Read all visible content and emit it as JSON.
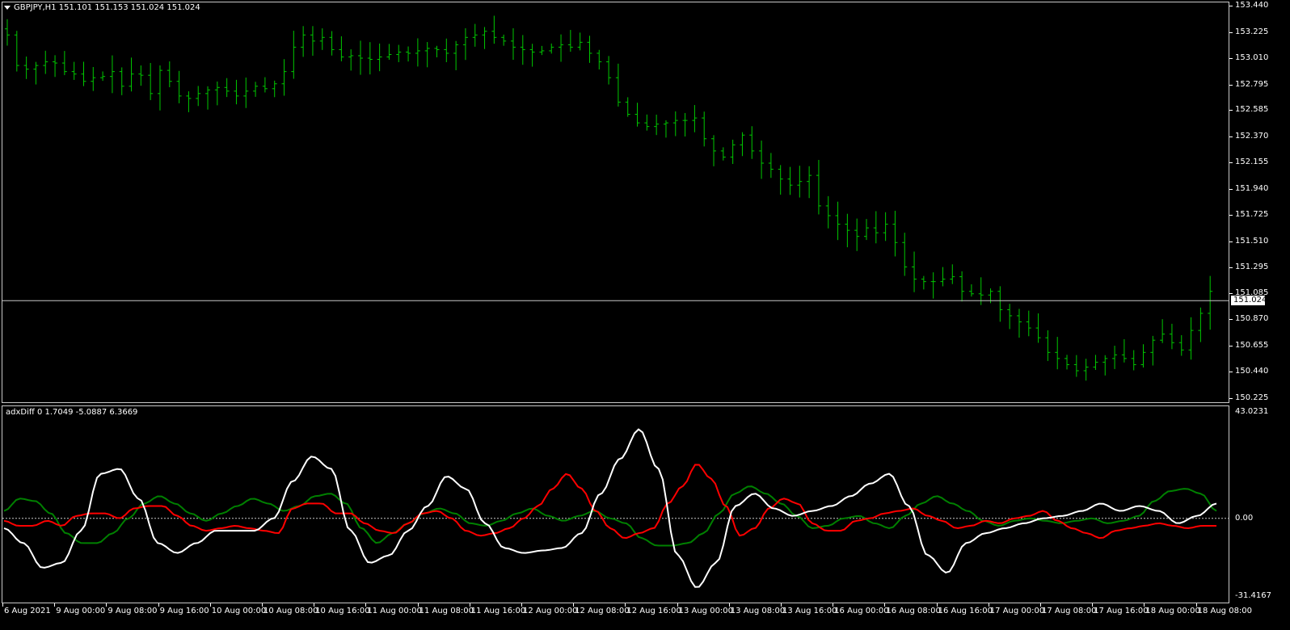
{
  "chart_title": "GBPJPY,H1  151.101 151.153 151.024 151.024",
  "current_price": "151.024",
  "indicator_title": "adxDiff 0 1.7049 -5.0887 6.3669",
  "price_axis": [
    "153.440",
    "153.225",
    "153.010",
    "152.795",
    "152.585",
    "152.370",
    "152.155",
    "151.940",
    "151.725",
    "151.510",
    "151.295",
    "151.085",
    "150.870",
    "150.655",
    "150.440",
    "150.225"
  ],
  "indicator_axis": [
    "43.0231",
    "0.00",
    "-31.4167"
  ],
  "time_axis": [
    "6 Aug 2021",
    "9 Aug 00:00",
    "9 Aug 08:00",
    "9 Aug 16:00",
    "10 Aug 00:00",
    "10 Aug 08:00",
    "10 Aug 16:00",
    "11 Aug 00:00",
    "11 Aug 08:00",
    "11 Aug 16:00",
    "12 Aug 00:00",
    "12 Aug 08:00",
    "12 Aug 16:00",
    "13 Aug 00:00",
    "13 Aug 08:00",
    "13 Aug 16:00",
    "16 Aug 00:00",
    "16 Aug 08:00",
    "16 Aug 16:00",
    "17 Aug 00:00",
    "17 Aug 08:00",
    "17 Aug 16:00",
    "18 Aug 00:00",
    "18 Aug 08:00"
  ],
  "colors": {
    "bars": "#00c800",
    "plus_di": "#008000",
    "minus_di": "#ff0000",
    "adx_diff": "#ffffff",
    "grid": "#c8c8c8"
  },
  "chart_data": {
    "type": "line",
    "price_range": [
      150.225,
      153.44
    ],
    "indicator_range": [
      -31.4167,
      43.0231
    ],
    "closes": [
      153.2,
      152.95,
      152.92,
      152.95,
      152.98,
      152.97,
      152.9,
      152.88,
      152.82,
      152.85,
      152.86,
      152.9,
      152.78,
      152.88,
      152.87,
      152.72,
      152.91,
      152.82,
      152.7,
      152.68,
      152.72,
      152.75,
      152.77,
      152.74,
      152.7,
      152.74,
      152.78,
      152.76,
      152.8,
      152.9,
      153.1,
      153.2,
      153.15,
      153.18,
      153.08,
      153.02,
      153.03,
      153.01,
      153.0,
      153.02,
      153.04,
      153.06,
      153.05,
      153.07,
      153.09,
      153.08,
      153.05,
      153.12,
      153.18,
      153.2,
      153.23,
      153.18,
      153.15,
      153.1,
      153.08,
      153.06,
      153.07,
      153.1,
      153.12,
      153.1,
      153.14,
      153.05,
      152.98,
      152.85,
      152.65,
      152.55,
      152.48,
      152.45,
      152.47,
      152.48,
      152.5,
      152.5,
      152.52,
      152.35,
      152.25,
      152.2,
      152.3,
      152.38,
      152.25,
      152.15,
      152.1,
      152.02,
      151.97,
      152.0,
      152.05,
      151.8,
      151.72,
      151.65,
      151.6,
      151.55,
      151.62,
      151.58,
      151.65,
      151.5,
      151.3,
      151.2,
      151.18,
      151.18,
      151.2,
      151.22,
      151.1,
      151.08,
      151.07,
      151.1,
      150.95,
      150.9,
      150.85,
      150.8,
      150.72,
      150.6,
      150.55,
      150.5,
      150.45,
      150.48,
      150.52,
      150.55,
      150.58,
      150.55,
      150.5,
      150.6,
      150.7,
      150.75,
      150.68,
      150.62,
      150.78,
      150.92,
      151.1
    ],
    "series": [
      {
        "name": "+DI",
        "values": [
          3,
          8,
          7,
          2,
          -6,
          -10,
          -10,
          -6,
          0,
          6,
          9,
          6,
          2,
          -1,
          2,
          5,
          8,
          6,
          3,
          5,
          9,
          10,
          6,
          -4,
          -10,
          -6,
          -2,
          2,
          4,
          2,
          -2,
          -3,
          -1,
          2,
          4,
          1,
          -1,
          1,
          3,
          0,
          -2,
          -8,
          -11,
          -11,
          -10,
          -6,
          2,
          10,
          13,
          10,
          6,
          1,
          -4,
          -3,
          0,
          1,
          -2,
          -4,
          1,
          6,
          9,
          6,
          3,
          -1,
          -3,
          -1,
          0,
          -1,
          -2,
          -1,
          0,
          -2,
          -1,
          1,
          7,
          11,
          12,
          10,
          3
        ]
      },
      {
        "name": "-DI",
        "values": [
          -1,
          -3,
          -3,
          -1,
          -3,
          1,
          2,
          2,
          0,
          4,
          5,
          5,
          1,
          -3,
          -5,
          -4,
          -3,
          -4,
          -5,
          -6,
          4,
          6,
          6,
          2,
          2,
          -2,
          -5,
          -6,
          -2,
          2,
          3,
          0,
          -5,
          -7,
          -6,
          -4,
          0,
          5,
          12,
          18,
          12,
          3,
          -4,
          -8,
          -6,
          -4,
          6,
          13,
          22,
          16,
          5,
          -7,
          -4,
          4,
          8,
          6,
          -2,
          -5,
          -5,
          -1,
          0,
          2,
          3,
          4,
          1,
          -1,
          -4,
          -3,
          -1,
          -2,
          0,
          1,
          3,
          -1,
          -4,
          -6,
          -8,
          -5,
          -4,
          -3,
          -2,
          -3,
          -4,
          -3,
          -3
        ]
      },
      {
        "name": "adxDiff",
        "values": [
          -4,
          -10,
          -20,
          -18,
          -5,
          18,
          20,
          8,
          -10,
          -14,
          -10,
          -5,
          -5,
          -5,
          0,
          15,
          25,
          20,
          -5,
          -18,
          -15,
          -5,
          5,
          17,
          12,
          -2,
          -12,
          -14,
          -13,
          -12,
          -6,
          10,
          24,
          36,
          20,
          -15,
          -28,
          -18,
          5,
          10,
          4,
          1,
          3,
          5,
          9,
          14,
          18,
          5,
          -15,
          -22,
          -10,
          -6,
          -4,
          -2,
          0,
          1,
          3,
          6,
          3,
          5,
          3,
          -2,
          1,
          6
        ]
      }
    ]
  }
}
